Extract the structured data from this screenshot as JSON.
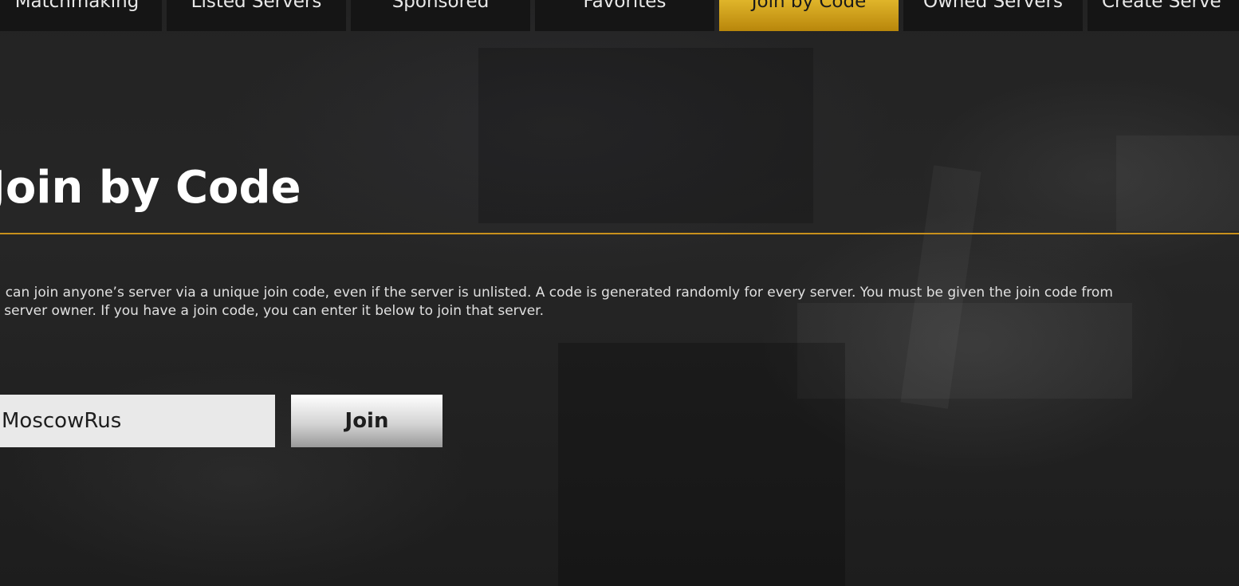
{
  "tabs": [
    {
      "label": "Matchmaking",
      "active": false
    },
    {
      "label": "Listed Servers",
      "active": false
    },
    {
      "label": "Sponsored",
      "active": false
    },
    {
      "label": "Favorites",
      "active": false
    },
    {
      "label": "Join by Code",
      "active": true
    },
    {
      "label": "Owned Servers",
      "active": false
    },
    {
      "label": "Create Serve",
      "active": false
    }
  ],
  "page": {
    "title": "Join by Code",
    "description": "You can join anyone’s server via a unique join code, even if the server is unlisted. A code is generated randomly for every server. You must be given the join code from the server owner. If you have a join code, you can enter it below to join that server."
  },
  "form": {
    "code_value": "MoscowRus",
    "join_label": "Join"
  },
  "colors": {
    "accent": "#c8901c",
    "active_tab": "#d4a017",
    "tab_background": "#151515",
    "input_background": "#e9e9e9"
  }
}
